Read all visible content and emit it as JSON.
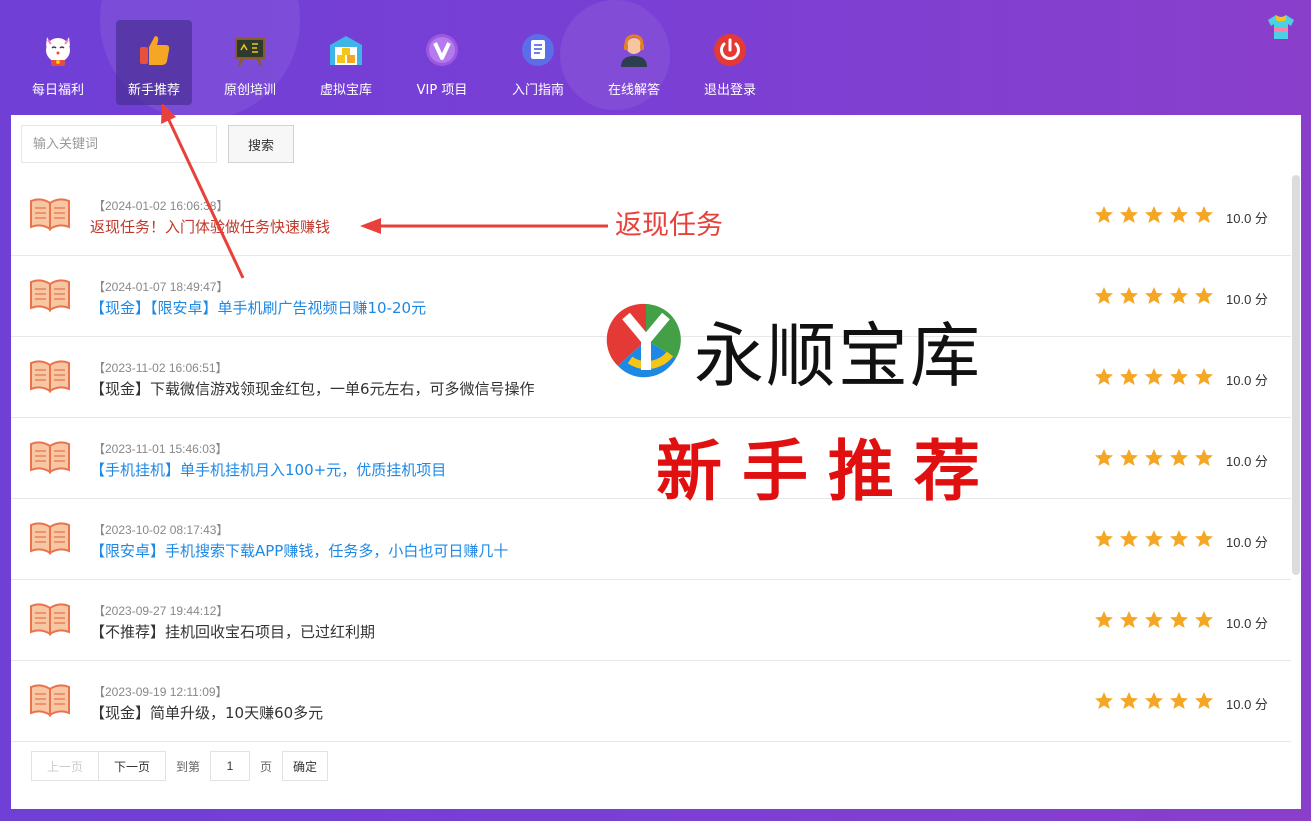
{
  "nav": {
    "items": [
      {
        "label": "每日福利",
        "icon": "lucky-cat-icon",
        "active": false
      },
      {
        "label": "新手推荐",
        "icon": "thumbs-up-icon",
        "active": true
      },
      {
        "label": "原创培训",
        "icon": "blackboard-icon",
        "active": false
      },
      {
        "label": "虚拟宝库",
        "icon": "warehouse-icon",
        "active": false
      },
      {
        "label": "VIP 项目",
        "icon": "vip-icon",
        "active": false
      },
      {
        "label": "入门指南",
        "icon": "document-icon",
        "active": false
      },
      {
        "label": "在线解答",
        "icon": "support-agent-icon",
        "active": false
      },
      {
        "label": "退出登录",
        "icon": "power-icon",
        "active": false
      }
    ]
  },
  "search": {
    "placeholder": "输入关键词",
    "value": "",
    "button_label": "搜索"
  },
  "list": {
    "items": [
      {
        "date": "【2024-01-02 16:06:38】",
        "title": "返现任务！入门体验做任务快速赚钱",
        "color": "#c0392b",
        "rating": 5,
        "score": "10.0 分"
      },
      {
        "date": "【2024-01-07 18:49:47】",
        "title": "【现金】【限安卓】单手机刷广告视频日赚10-20元",
        "color": "#1e88e5",
        "rating": 5,
        "score": "10.0 分"
      },
      {
        "date": "【2023-11-02 16:06:51】",
        "title": "【现金】下载微信游戏领现金红包，一单6元左右，可多微信号操作",
        "color": "#333333",
        "rating": 5,
        "score": "10.0 分"
      },
      {
        "date": "【2023-11-01 15:46:03】",
        "title": "【手机挂机】单手机挂机月入100+元，优质挂机项目",
        "color": "#1e88e5",
        "rating": 5,
        "score": "10.0 分"
      },
      {
        "date": "【2023-10-02 08:17:43】",
        "title": "【限安卓】手机搜索下载APP赚钱，任务多，小白也可日赚几十",
        "color": "#1e88e5",
        "rating": 5,
        "score": "10.0 分"
      },
      {
        "date": "【2023-09-27 19:44:12】",
        "title": "【不推荐】挂机回收宝石项目，已过红利期",
        "color": "#333333",
        "rating": 5,
        "score": "10.0 分"
      },
      {
        "date": "【2023-09-19 12:11:09】",
        "title": "【现金】简单升级，10天赚60多元",
        "color": "#333333",
        "rating": 5,
        "score": "10.0 分"
      }
    ]
  },
  "pager": {
    "prev": "上一页",
    "next": "下一页",
    "goto_prefix": "到第",
    "page": "1",
    "goto_suffix": "页",
    "confirm": "确定"
  },
  "overlay": {
    "annotation": "返现任务",
    "brand_name": "永顺宝库",
    "big_title": "新手推荐",
    "arrow_color": "#e8413b"
  },
  "colors": {
    "accent": "#7a3fd4",
    "star": "#f5a623",
    "active_nav": "#3c2882"
  }
}
